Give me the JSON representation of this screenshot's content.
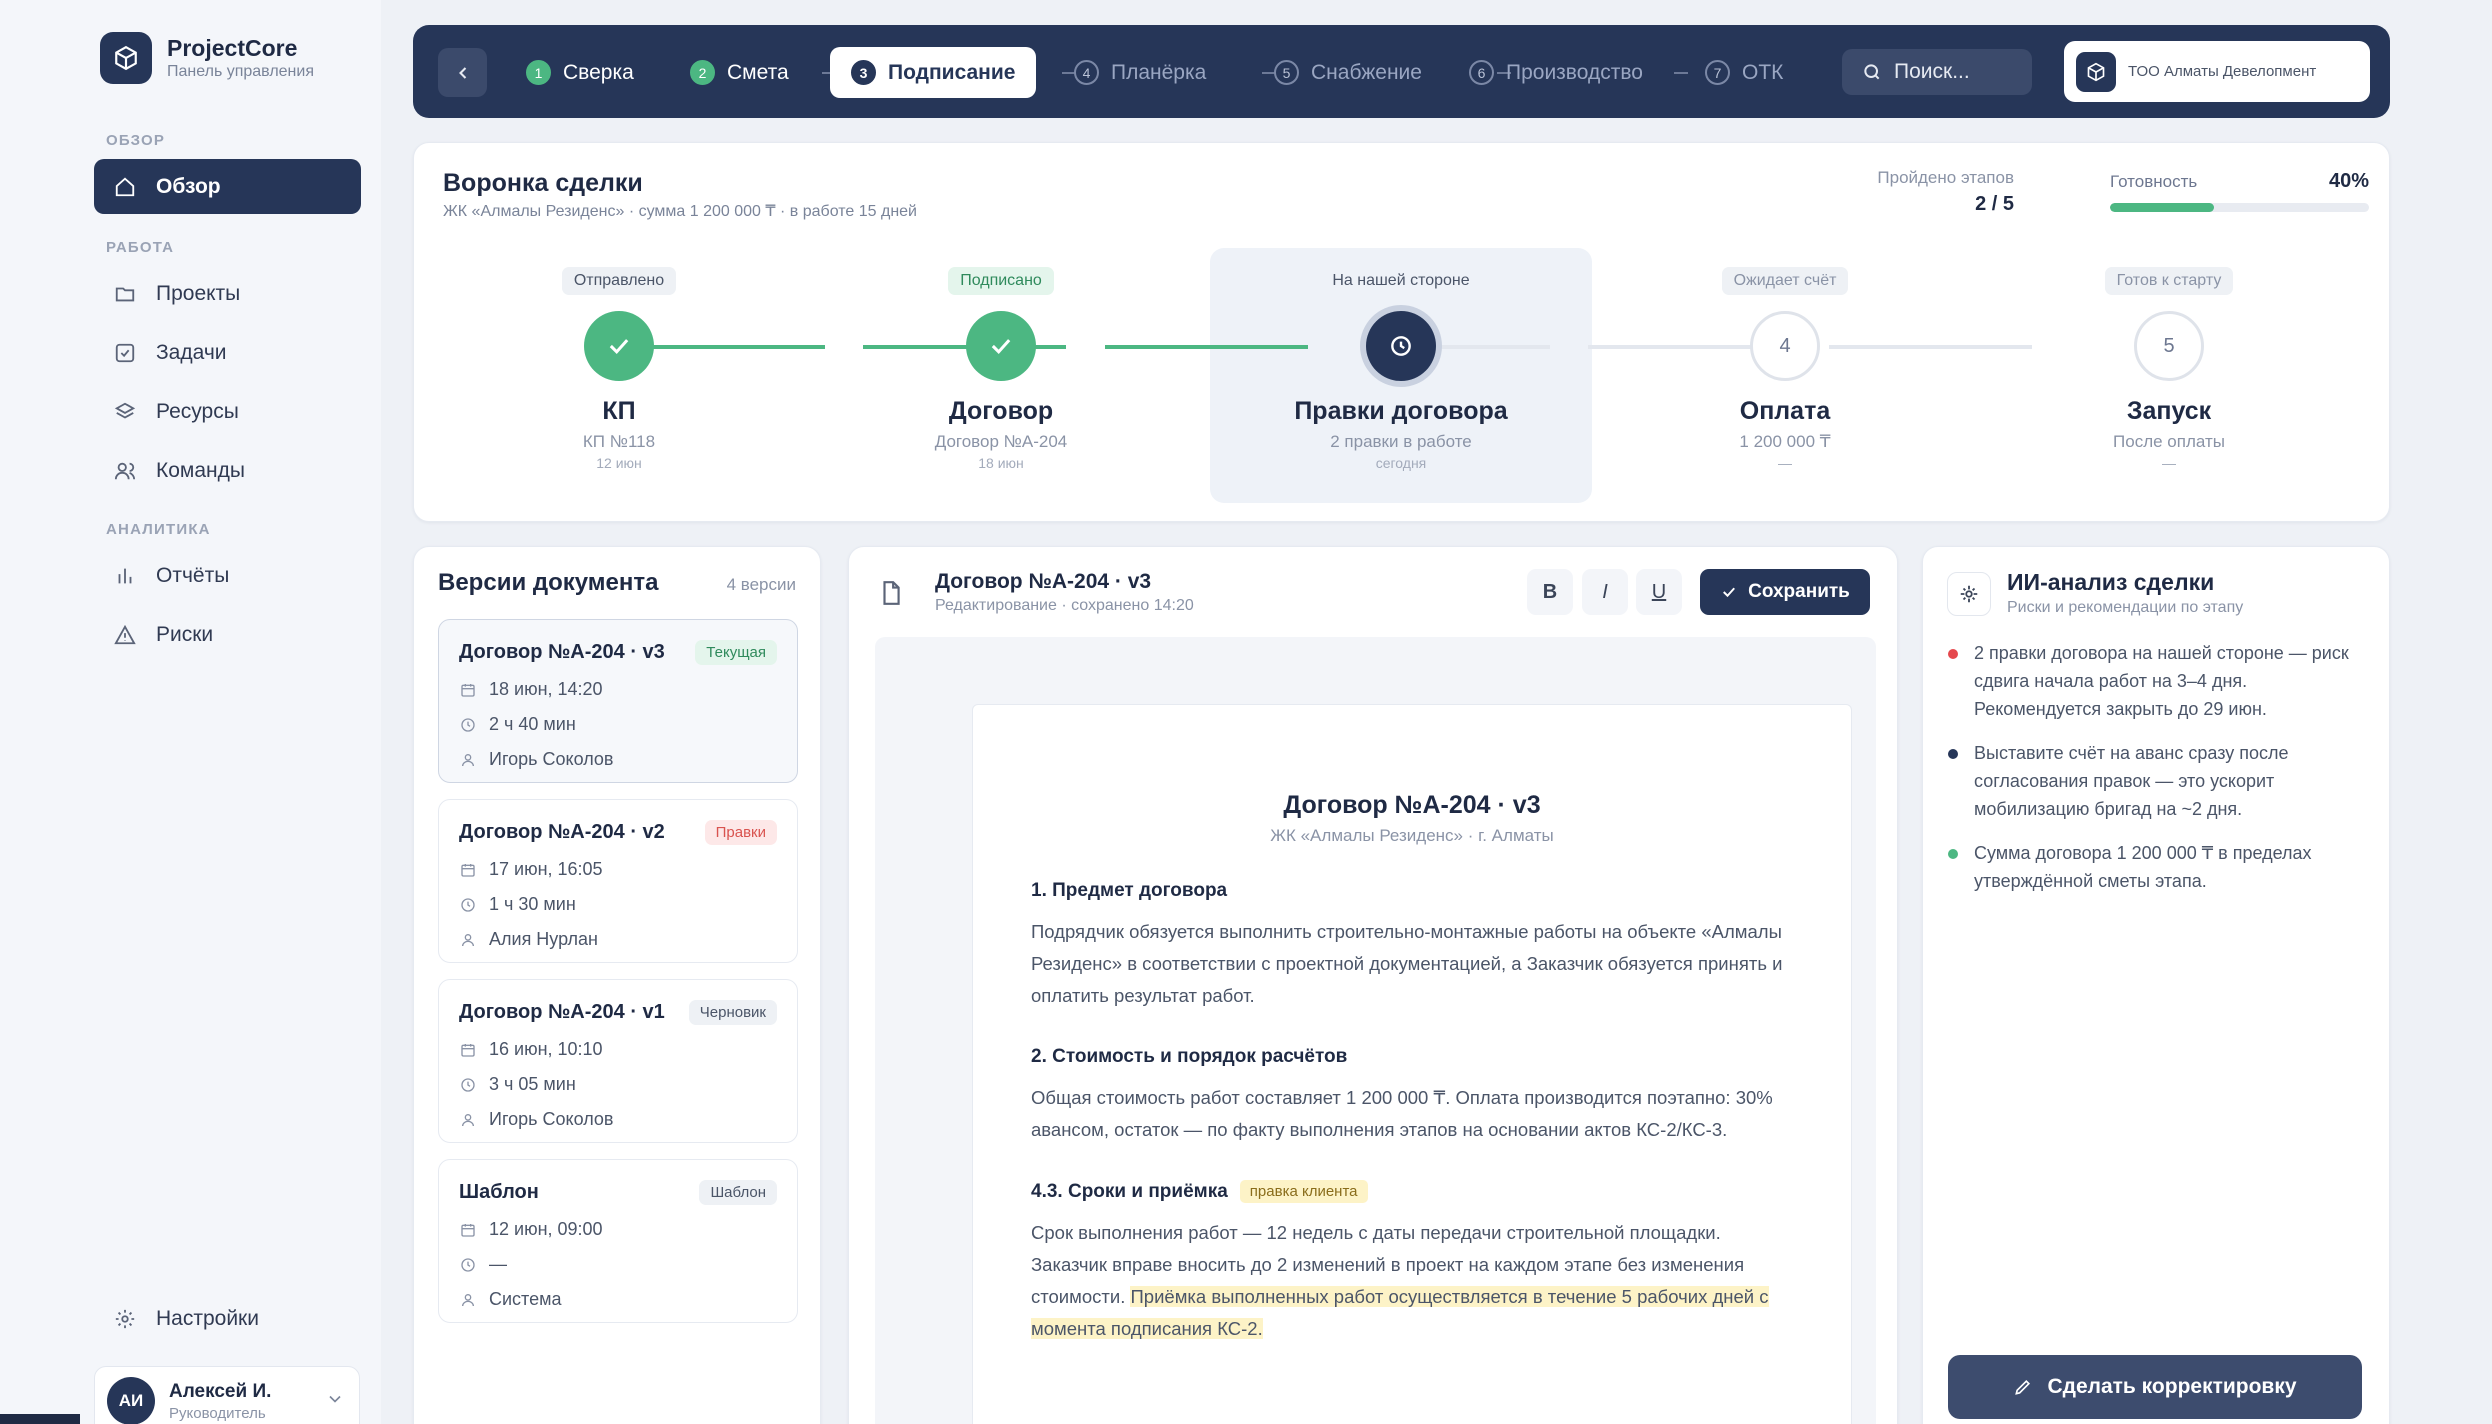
{
  "brand": {
    "name": "ProjectCore",
    "subtitle": "Панель управления"
  },
  "sidebar": {
    "sections": [
      {
        "label": "ОБЗОР",
        "items": [
          {
            "label": "Обзор",
            "icon": "home-icon",
            "active": true
          }
        ]
      },
      {
        "label": "РАБОТА",
        "items": [
          {
            "label": "Проекты",
            "icon": "folder-icon"
          },
          {
            "label": "Задачи",
            "icon": "checkbox-icon"
          },
          {
            "label": "Ресурсы",
            "icon": "layers-icon"
          },
          {
            "label": "Команды",
            "icon": "users-icon"
          }
        ]
      },
      {
        "label": "АНАЛИТИКА",
        "items": [
          {
            "label": "Отчёты",
            "icon": "bar-chart-icon"
          },
          {
            "label": "Риски",
            "icon": "warning-icon"
          }
        ]
      }
    ],
    "settings_label": "Настройки",
    "user": {
      "initials": "АИ",
      "name": "Алексей И.",
      "role": "Руководитель"
    }
  },
  "stepper": {
    "steps": [
      {
        "num": "1",
        "label": "Сверка",
        "state": "done"
      },
      {
        "num": "2",
        "label": "Смета",
        "state": "done"
      },
      {
        "num": "3",
        "label": "Подписание",
        "state": "current"
      },
      {
        "num": "4",
        "label": "Планёрка",
        "state": "todo"
      },
      {
        "num": "5",
        "label": "Снабжение",
        "state": "todo"
      },
      {
        "num": "6",
        "label": "Производство",
        "state": "todo"
      },
      {
        "num": "7",
        "label": "ОТК",
        "state": "todo"
      }
    ],
    "search_placeholder": "Поиск...",
    "org_name": "ТОО Алматы Девелопмент"
  },
  "funnel": {
    "title": "Воронка сделки",
    "subtitle": "ЖК «Алмалы Резиденс» · сумма 1 200 000 ₸ · в работе 15 дней",
    "stages_label": "Пройдено этапов",
    "stages_value": "2 / 5",
    "ready_label": "Готовность",
    "ready_value": "40%",
    "ready_fraction": 0.4,
    "stages": [
      {
        "badge": "Отправлено",
        "name": "КП",
        "sub": "КП №118",
        "date": "12 июн",
        "state": "done"
      },
      {
        "badge": "Подписано",
        "name": "Договор",
        "sub": "Договор №А-204",
        "date": "18 июн",
        "state": "done"
      },
      {
        "badge": "На нашей стороне",
        "name": "Правки договора",
        "sub": "2 правки в работе",
        "date": "сегодня",
        "state": "current"
      },
      {
        "badge": "Ожидает счёт",
        "name": "Оплата",
        "sub": "1 200 000 ₸",
        "date": "—",
        "state": "todo",
        "num": "4"
      },
      {
        "badge": "Готов к старту",
        "name": "Запуск",
        "sub": "После оплаты",
        "date": "—",
        "state": "todo",
        "num": "5"
      }
    ]
  },
  "versions": {
    "title": "Версии документа",
    "count": "4 версии",
    "items": [
      {
        "title": "Договор №А-204 · v3",
        "tag": "Текущая",
        "date": "18 июн, 14:20",
        "duration": "2 ч 40 мин",
        "author": "Игорь Соколов"
      },
      {
        "title": "Договор №А-204 · v2",
        "tag": "Правки",
        "date": "17 июн, 16:05",
        "duration": "1 ч 30 мин",
        "author": "Алия Нурлан"
      },
      {
        "title": "Договор №А-204 · v1",
        "tag": "Черновик",
        "date": "16 июн, 10:10",
        "duration": "3 ч 05 мин",
        "author": "Игорь Соколов"
      },
      {
        "title": "Шаблон",
        "tag": "Шаблон",
        "date": "12 июн, 09:00",
        "duration": "—",
        "author": "Система"
      }
    ]
  },
  "editor": {
    "title": "Договор №А-204 · v3",
    "subtitle": "Редактирование · сохранено 14:20",
    "bold": "B",
    "italic": "I",
    "underline": "U",
    "save_label": "Сохранить",
    "doc": {
      "title": "Договор №А-204 · v3",
      "subtitle": "ЖК «Алмалы Резиденс» · г. Алматы",
      "s1_title": "1. Предмет договора",
      "s1_text": "Подрядчик обязуется выполнить строительно-монтажные работы на объекте «Алмалы Резиденс» в соответствии с проектной документацией, а Заказчик обязуется принять и оплатить результат работ.",
      "s2_title": "2. Стоимость и порядок расчётов",
      "s2_text": "Общая стоимость работ составляет 1 200 000 ₸. Оплата производится поэтапно: 30% авансом, остаток — по факту выполнения этапов на основании актов КС-2/КС-3.",
      "s3_title": "4.3. Сроки и приёмка",
      "s3_tag": "правка клиента",
      "s3_text": "Срок выполнения работ — 12 недель с даты передачи строительной площадки. Заказчик вправе вносить до 2 изменений в проект на каждом этапе без изменения стоимости.",
      "s3_highlight": "Приёмка выполненных работ осуществляется в течение 5 рабочих дней с момента подписания КС-2."
    }
  },
  "ai": {
    "title": "ИИ-анализ сделки",
    "subtitle": "Риски и рекомендации по этапу",
    "items": [
      {
        "color": "#e5484d",
        "text": "2 правки договора на нашей стороне — риск сдвига начала работ на 3–4 дня. Рекомендуется закрыть до 29 июн."
      },
      {
        "color": "#263658",
        "text": "Выставите счёт на аванс сразу после согласования правок — это ускорит мобилизацию бригад на ~2 дня."
      },
      {
        "color": "#4cb782",
        "text": "Сумма договора 1 200 000 ₸ в пределах утверждённой сметы этапа."
      }
    ],
    "action_label": "Сделать корректировку"
  },
  "colors": {
    "primary": "#263658",
    "success": "#4cb782",
    "danger": "#e5484d",
    "highlight": "#fdf3c7"
  }
}
